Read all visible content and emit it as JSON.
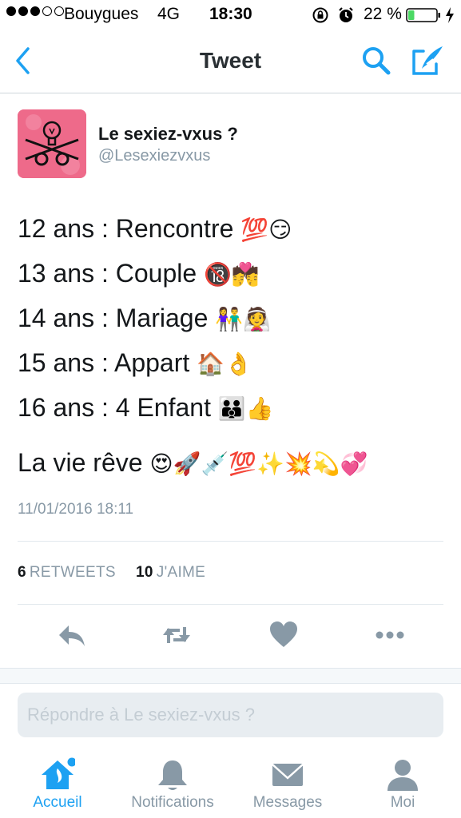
{
  "status_bar": {
    "carrier": "Bouygues",
    "network": "4G",
    "time": "18:30",
    "battery": "22 %",
    "battery_level": 0.22,
    "icons": [
      "signal-dots-icon",
      "rotation-lock-icon",
      "alarm-icon",
      "battery-icon",
      "charging-bolt-icon"
    ]
  },
  "nav": {
    "title": "Tweet",
    "icons": [
      "back-chevron-icon",
      "search-icon",
      "compose-icon"
    ]
  },
  "tweet": {
    "author_name": "Le sexiez-vxus ?",
    "handle": "@Lesexiezvxus",
    "lines": [
      {
        "text": "12 ans : Rencontre",
        "emoji": "💯😏"
      },
      {
        "text": "13 ans : Couple",
        "emoji": "🔞💏"
      },
      {
        "text": "14 ans : Mariage",
        "emoji": "👫👰"
      },
      {
        "text": "15 ans : Appart",
        "emoji": "🏠👌"
      },
      {
        "text": "16 ans : 4 Enfant",
        "emoji": "👪👍"
      },
      {
        "text": "La vie rêve",
        "emoji": "😍🚀💉💯✨💥💫💞"
      }
    ],
    "timestamp": "11/01/2016 18:11",
    "retweets_count": "6",
    "retweets_label": "RETWEETS",
    "likes_count": "10",
    "likes_label": "J'AIME"
  },
  "actions": [
    "reply-icon",
    "retweet-icon",
    "like-heart-icon",
    "more-dots-icon"
  ],
  "reply": {
    "placeholder": "Répondre à Le sexiez-vxus ?"
  },
  "tabs": [
    {
      "label": "Accueil",
      "icon": "home-icon",
      "active": true
    },
    {
      "label": "Notifications",
      "icon": "bell-icon",
      "active": false
    },
    {
      "label": "Messages",
      "icon": "envelope-icon",
      "active": false
    },
    {
      "label": "Moi",
      "icon": "person-icon",
      "active": false
    }
  ],
  "colors": {
    "accent": "#1da1f2",
    "muted": "#8899a6",
    "avatar_bg": "#ee6a8a",
    "battery_fill": "#4cd964"
  }
}
